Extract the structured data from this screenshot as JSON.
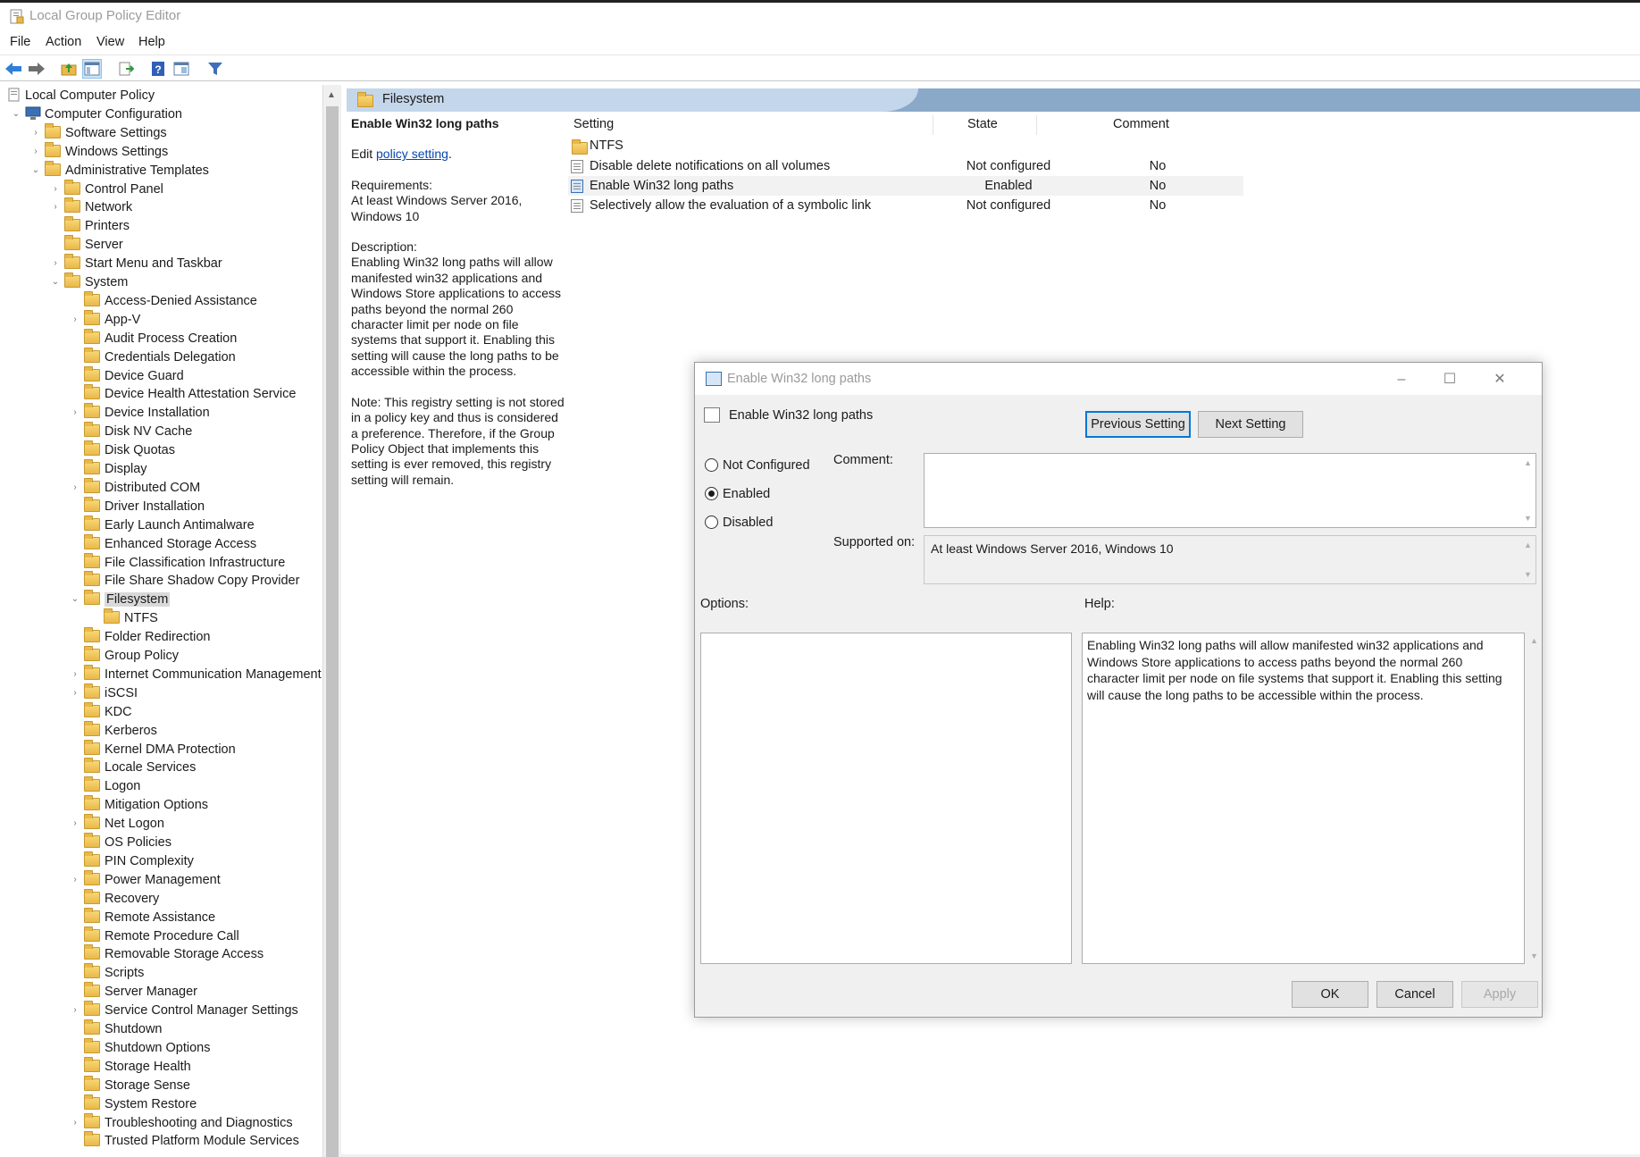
{
  "window": {
    "title": "Local Group Policy Editor"
  },
  "menu": [
    "File",
    "Action",
    "View",
    "Help"
  ],
  "toolbar": [
    "back-icon",
    "forward-icon",
    "up-folder-icon",
    "show-hide-tree-icon",
    "export-list-icon",
    "help-icon",
    "properties-icon",
    "filter-icon"
  ],
  "tree": {
    "root": "Local Computer Policy",
    "computer_config": "Computer Configuration",
    "software_settings": "Software Settings",
    "windows_settings": "Windows Settings",
    "admin_templates": "Administrative Templates",
    "admin_children": [
      "Control Panel",
      "Network",
      "Printers",
      "Server",
      "Start Menu and Taskbar",
      "System"
    ],
    "system_children_before": [
      "Access-Denied Assistance",
      "App-V",
      "Audit Process Creation",
      "Credentials Delegation",
      "Device Guard",
      "Device Health Attestation Service",
      "Device Installation",
      "Disk NV Cache",
      "Disk Quotas",
      "Display",
      "Distributed COM",
      "Driver Installation",
      "Early Launch Antimalware",
      "Enhanced Storage Access",
      "File Classification Infrastructure",
      "File Share Shadow Copy Provider"
    ],
    "filesystem": "Filesystem",
    "ntfs": "NTFS",
    "system_children_after": [
      "Folder Redirection",
      "Group Policy",
      "Internet Communication Management",
      "iSCSI",
      "KDC",
      "Kerberos",
      "Kernel DMA Protection",
      "Locale Services",
      "Logon",
      "Mitigation Options",
      "Net Logon",
      "OS Policies",
      "PIN Complexity",
      "Power Management",
      "Recovery",
      "Remote Assistance",
      "Remote Procedure Call",
      "Removable Storage Access",
      "Scripts",
      "Server Manager",
      "Service Control Manager Settings",
      "Shutdown",
      "Shutdown Options",
      "Storage Health",
      "Storage Sense",
      "System Restore",
      "Troubleshooting and Diagnostics",
      "Trusted Platform Module Services"
    ]
  },
  "pane": {
    "tab_title": "Filesystem",
    "description": {
      "title": "Enable Win32 long paths",
      "edit_prefix": "Edit ",
      "edit_link": "policy setting",
      "edit_suffix": ".",
      "requirements_label": "Requirements:",
      "requirements": "At least Windows Server 2016, Windows 10",
      "description_label": "Description:",
      "description": "Enabling Win32 long paths will allow manifested win32 applications and Windows Store applications to access paths beyond the normal 260 character limit per node on file systems that support it.  Enabling this setting will cause the long paths to be accessible within the process.",
      "note": "Note:  This registry setting is not stored in a policy key and thus is considered a preference.  Therefore, if the Group Policy Object that implements this setting is ever removed, this registry setting will remain."
    },
    "columns": {
      "setting": "Setting",
      "state": "State",
      "comment": "Comment"
    },
    "folder_row": "NTFS",
    "rows": [
      {
        "name": "Disable delete notifications on all volumes",
        "state": "Not configured",
        "comment": "No"
      },
      {
        "name": "Enable Win32 long paths",
        "state": "Enabled",
        "comment": "No"
      },
      {
        "name": "Selectively allow the evaluation of a symbolic link",
        "state": "Not configured",
        "comment": "No"
      }
    ]
  },
  "dialog": {
    "title": "Enable Win32 long paths",
    "setting_name": "Enable Win32 long paths",
    "previous_button": "Previous Setting",
    "next_button": "Next Setting",
    "radio_not_configured": "Not Configured",
    "radio_enabled": "Enabled",
    "radio_disabled": "Disabled",
    "selected_option": "Enabled",
    "comment_label": "Comment:",
    "comment_value": "",
    "supported_label": "Supported on:",
    "supported_value": "At least Windows Server 2016, Windows 10",
    "options_label": "Options:",
    "help_label": "Help:",
    "help_text": "Enabling Win32 long paths will allow manifested win32 applications and Windows Store applications to access paths beyond the normal 260 character limit per node on file systems that support it.  Enabling this setting will cause the long paths to be accessible within the process.",
    "ok_button": "OK",
    "cancel_button": "Cancel",
    "apply_button": "Apply"
  }
}
